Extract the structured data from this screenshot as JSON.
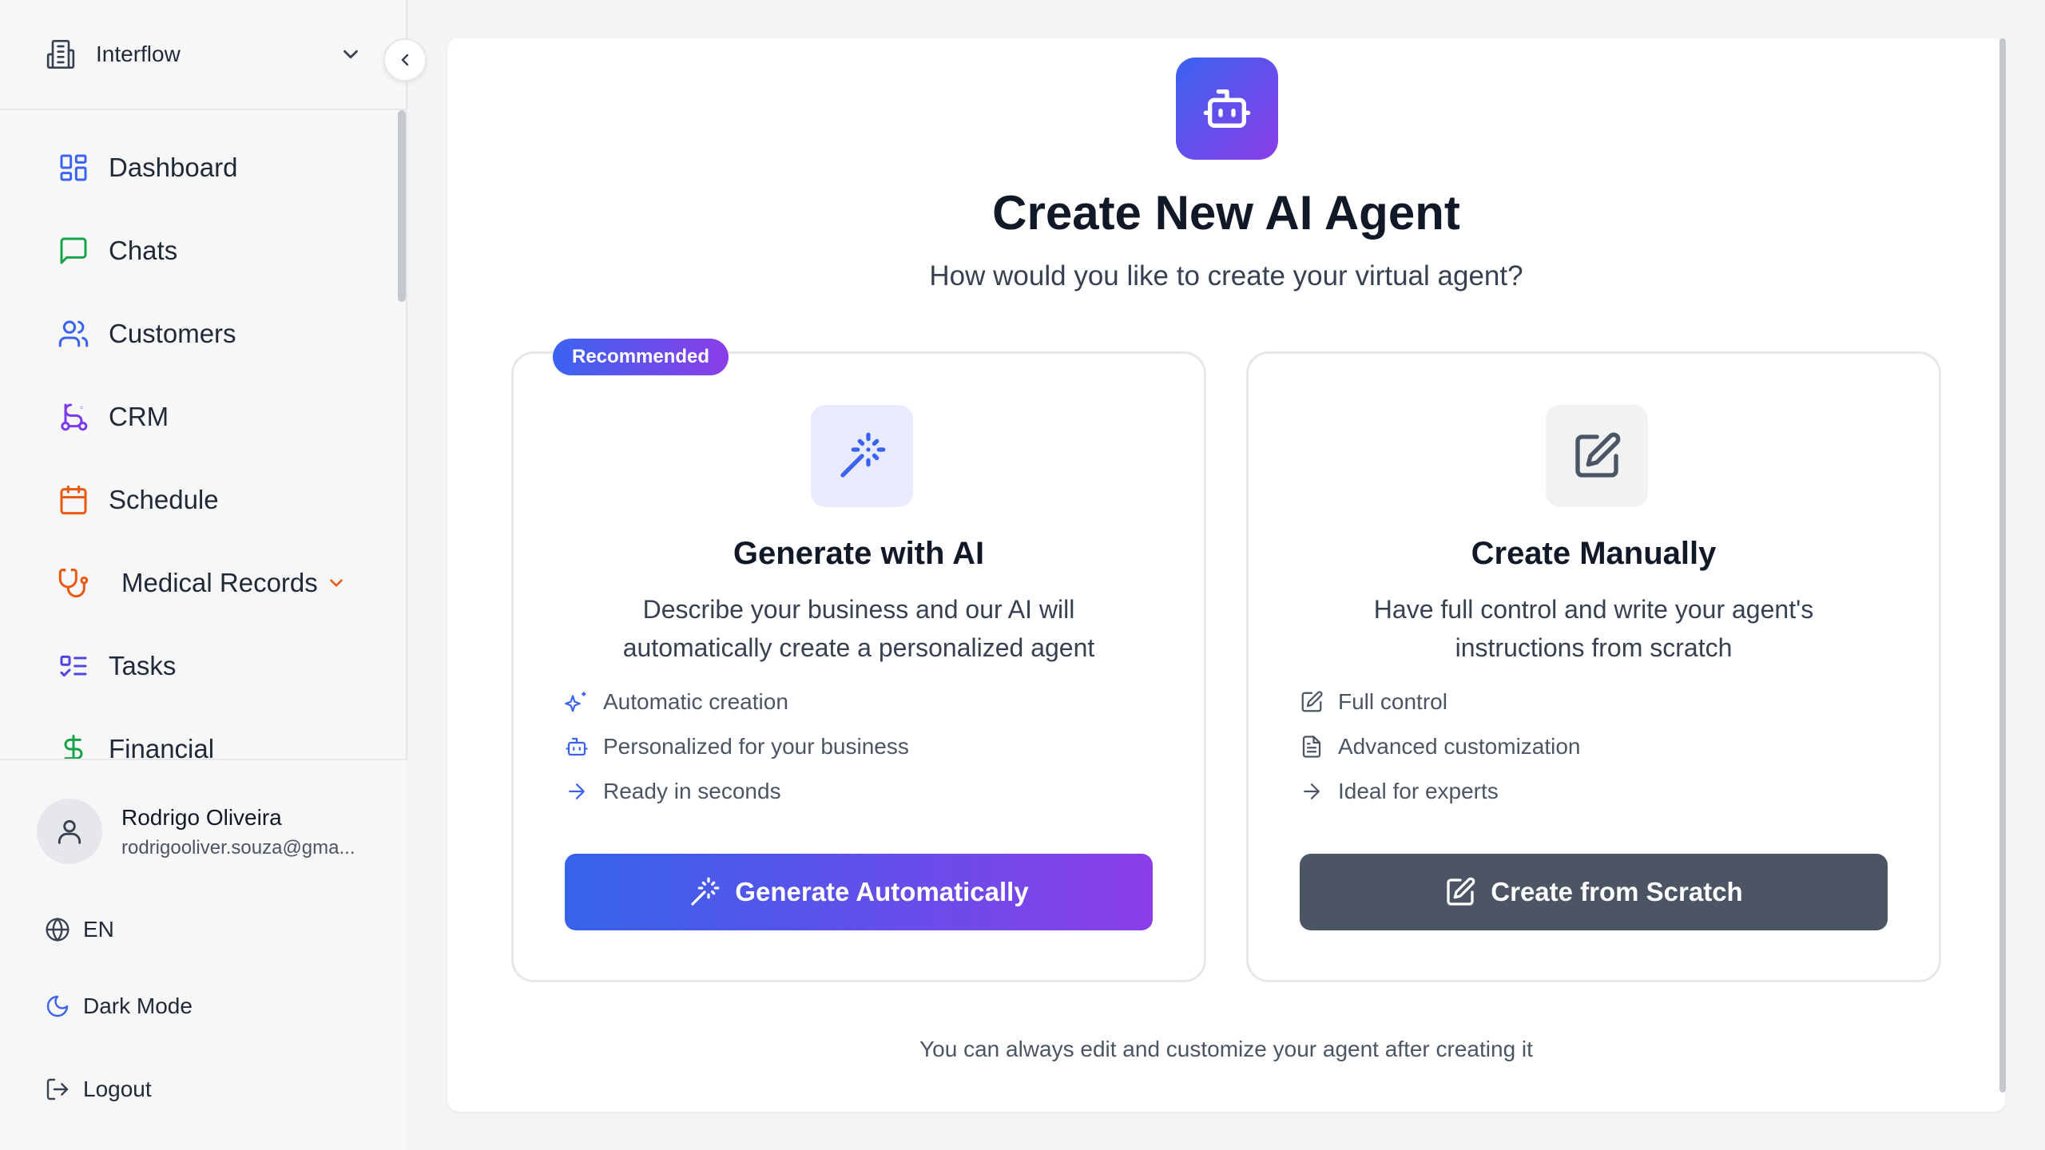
{
  "sidebar": {
    "org_name": "Interflow",
    "nav": [
      {
        "label": "Dashboard",
        "icon": "dashboard-icon",
        "color": "#3b63f0"
      },
      {
        "label": "Chats",
        "icon": "chat-icon",
        "color": "#16a34a"
      },
      {
        "label": "Customers",
        "icon": "users-icon",
        "color": "#3b63f0"
      },
      {
        "label": "CRM",
        "icon": "route-icon",
        "color": "#7c3aed"
      },
      {
        "label": "Schedule",
        "icon": "calendar-icon",
        "color": "#ea580c"
      },
      {
        "label": "Medical Records",
        "icon": "stethoscope-icon",
        "color": "#ea580c"
      },
      {
        "label": "Tasks",
        "icon": "list-todo-icon",
        "color": "#4f46e5"
      },
      {
        "label": "Financial",
        "icon": "dollar-icon",
        "color": "#16a34a"
      }
    ],
    "user": {
      "name": "Rodrigo Oliveira",
      "email": "rodrigooliver.souza@gma..."
    },
    "language": "EN",
    "dark_mode": "Dark Mode",
    "logout": "Logout"
  },
  "main": {
    "title": "Create New AI Agent",
    "subtitle": "How would you like to create your virtual agent?",
    "options": [
      {
        "badge": "Recommended",
        "title": "Generate with AI",
        "description": "Describe your business and our AI will automatically create a personalized agent",
        "features": [
          "Automatic creation",
          "Personalized for your business",
          "Ready in seconds"
        ],
        "button": "Generate Automatically"
      },
      {
        "title": "Create Manually",
        "description": "Have full control and write your agent's instructions from scratch",
        "features": [
          "Full control",
          "Advanced customization",
          "Ideal for experts"
        ],
        "button": "Create from Scratch"
      }
    ],
    "footnote": "You can always edit and customize your agent after creating it"
  },
  "colors": {
    "accent_start": "#3b63f0",
    "accent_end": "#8b3ee8",
    "dark_button": "#4b5563"
  }
}
